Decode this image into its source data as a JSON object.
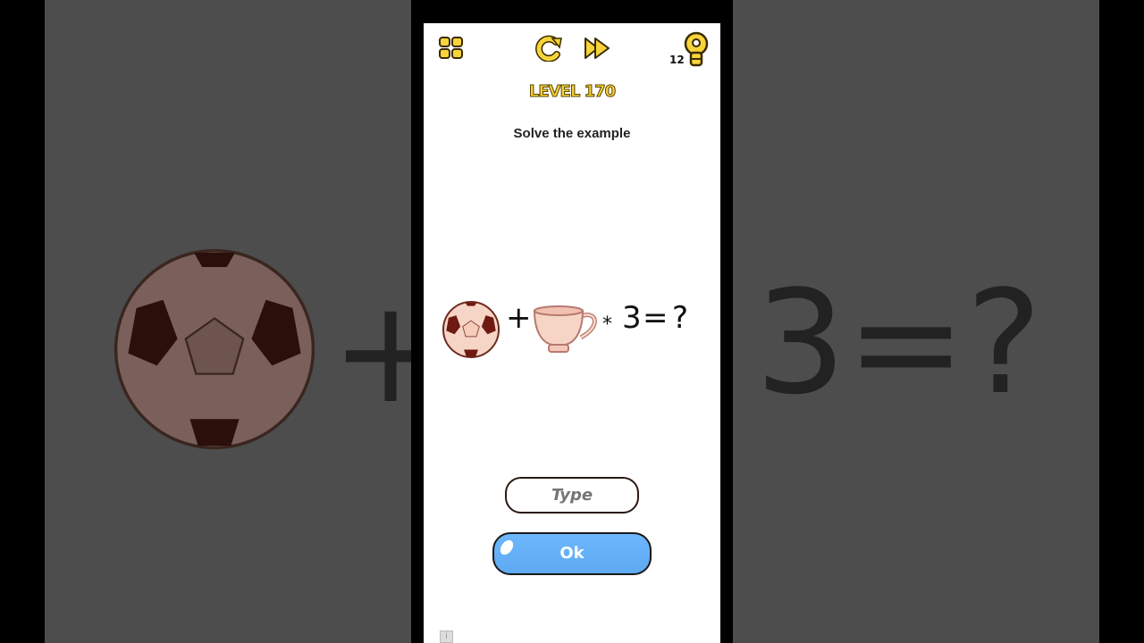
{
  "header": {
    "level_title": "LEVEL 170",
    "hint_count": "12",
    "icons": [
      "levels-grid-icon",
      "restart-icon",
      "skip-icon",
      "lightbulb-hint-icon"
    ]
  },
  "puzzle": {
    "instruction": "Solve the example",
    "plus": "+",
    "times": "*",
    "number": "3",
    "equals": "=",
    "question": "?",
    "items": [
      "soccer-ball",
      "teacup"
    ]
  },
  "answer": {
    "placeholder": "Type",
    "value": ""
  },
  "ok_label": "Ok",
  "info_icon": "i",
  "colors": {
    "accent": "#f7d43a",
    "button": "#66b0f8"
  }
}
